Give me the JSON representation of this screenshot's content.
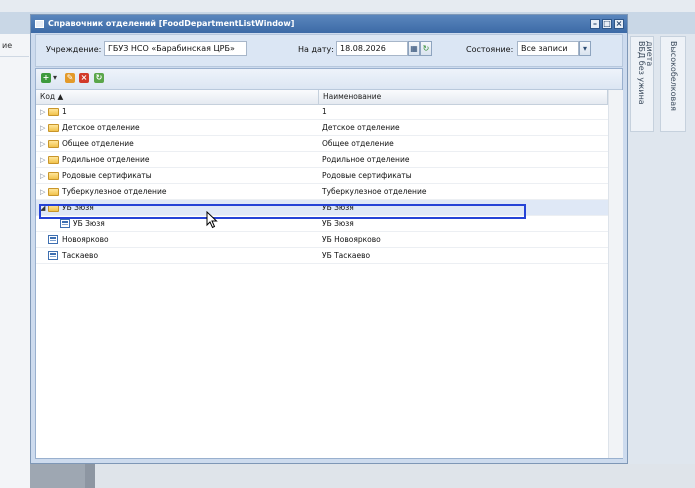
{
  "background": {
    "left_tab": "ие",
    "right_tabs": [
      "ВБД без ужина",
      "Высокобелковая диета"
    ]
  },
  "window": {
    "title": "Справочник отделений [FoodDepartmentListWindow]"
  },
  "filters": {
    "institution_label": "Учреждение:",
    "institution_value": "ГБУЗ НСО «Барабинская ЦРБ»",
    "date_label": "На дату:",
    "date_value": "18.08.2026",
    "state_label": "Состояние:",
    "state_value": "Все записи"
  },
  "grid": {
    "col_code": "Код",
    "col_name": "Наименование",
    "rows": [
      {
        "code": "1",
        "name": "1"
      },
      {
        "code": "Детское отделение",
        "name": "Детское отделение"
      },
      {
        "code": "Общее отделение",
        "name": "Общее отделение"
      },
      {
        "code": "Родильное отделение",
        "name": "Родильное отделение"
      },
      {
        "code": "Родовые сертификаты",
        "name": "Родовые сертификаты"
      },
      {
        "code": "Туберкулезное отделение",
        "name": "Туберкулезное отделение"
      },
      {
        "code": "УБ Зюзя",
        "name": "УБ Зюзя"
      },
      {
        "code": "УБ Зюзя",
        "name": "УБ Зюзя"
      },
      {
        "code": "Новоярково",
        "name": "УБ Новоярково"
      },
      {
        "code": "Таскаево",
        "name": "УБ Таскаево"
      }
    ]
  }
}
